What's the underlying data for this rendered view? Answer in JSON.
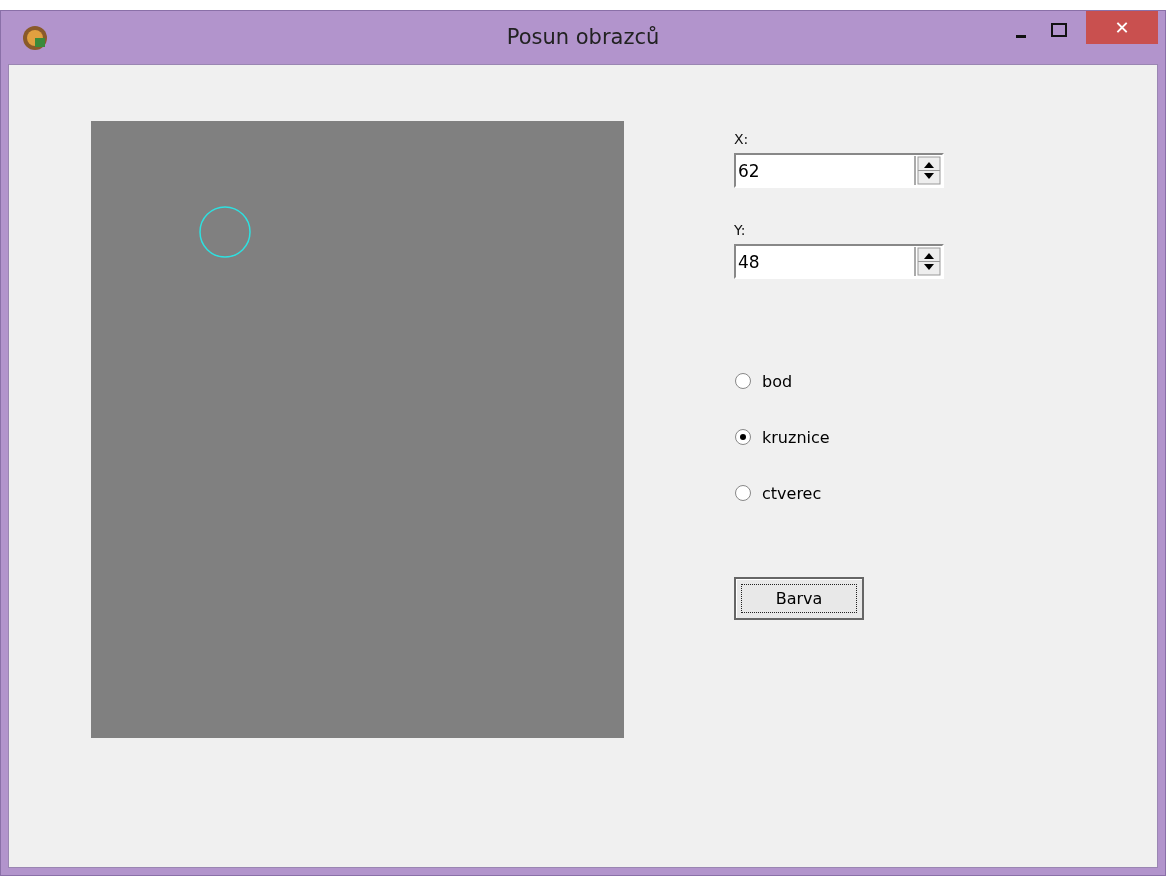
{
  "window": {
    "title": "Posun obrazců"
  },
  "title_buttons": [
    {
      "kind": "minimize"
    },
    {
      "kind": "maximize"
    },
    {
      "kind": "close",
      "label": "✕"
    }
  ],
  "fields": [
    {
      "label": "X:",
      "value": "62"
    },
    {
      "label": "Y:",
      "value": "48"
    }
  ],
  "shapes": [
    {
      "label": "bod",
      "selected": false
    },
    {
      "label": "kruznice",
      "selected": true
    },
    {
      "label": "ctverec",
      "selected": false
    }
  ],
  "buttons": [
    {
      "label": "Barva",
      "focused": true
    }
  ]
}
